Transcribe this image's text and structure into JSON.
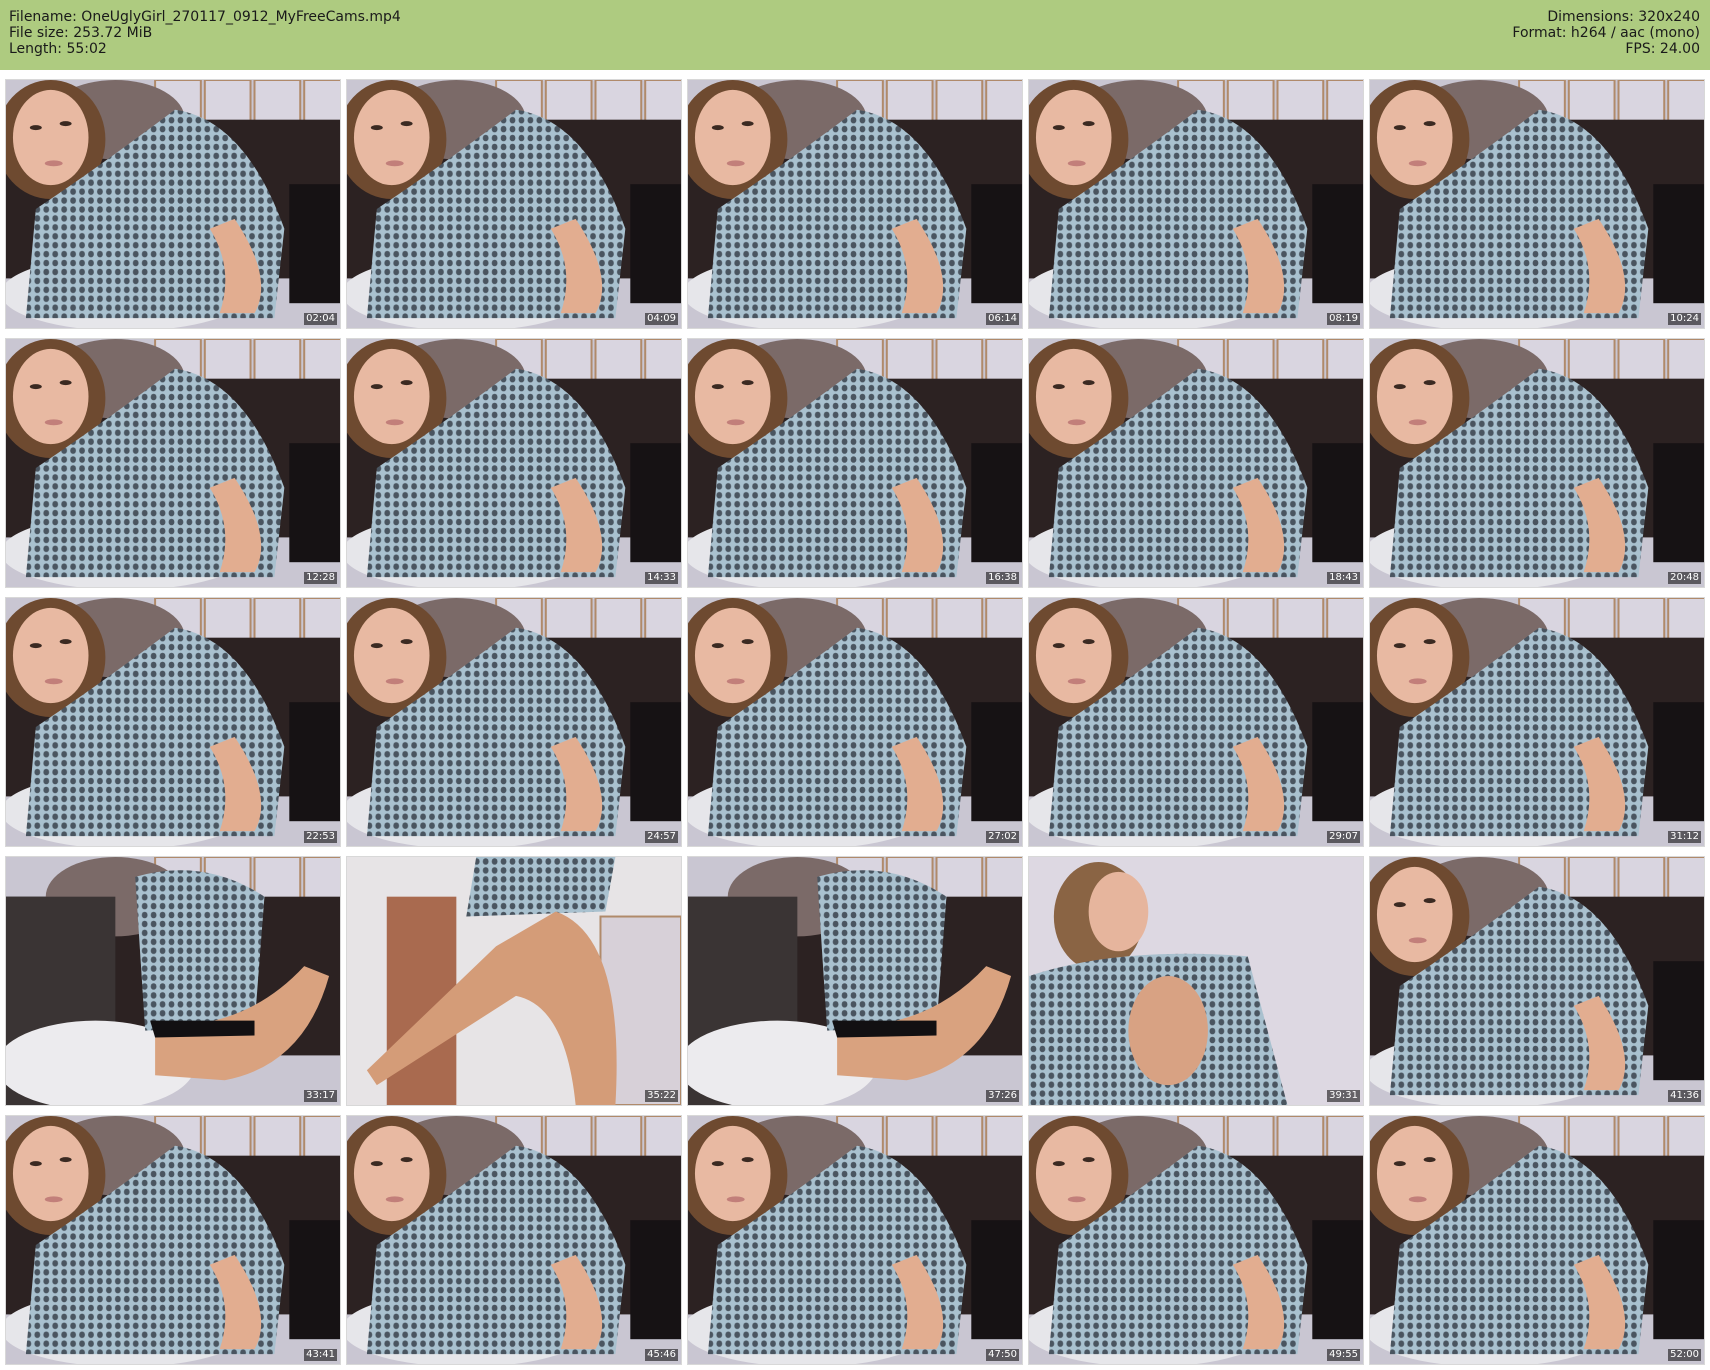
{
  "header": {
    "filename": "Filename: OneUglyGirl_270117_0912_MyFreeCams.mp4",
    "filesize": "File size: 253.72 MiB",
    "length": "Length: 55:02",
    "dimensions": "Dimensions: 320x240",
    "format": "Format: h264 / aac (mono)",
    "fps": "FPS: 24.00"
  },
  "colors": {
    "header_bg": "#aecb80"
  },
  "thumbnails": [
    {
      "time": "02:04",
      "variant": "close"
    },
    {
      "time": "04:09",
      "variant": "lying"
    },
    {
      "time": "06:14",
      "variant": "lying"
    },
    {
      "time": "08:19",
      "variant": "lying"
    },
    {
      "time": "10:24",
      "variant": "lying"
    },
    {
      "time": "12:28",
      "variant": "lying"
    },
    {
      "time": "14:33",
      "variant": "lying"
    },
    {
      "time": "16:38",
      "variant": "lying"
    },
    {
      "time": "18:43",
      "variant": "lying"
    },
    {
      "time": "20:48",
      "variant": "lying"
    },
    {
      "time": "22:53",
      "variant": "lying"
    },
    {
      "time": "24:57",
      "variant": "lying"
    },
    {
      "time": "27:02",
      "variant": "lying"
    },
    {
      "time": "29:07",
      "variant": "lying"
    },
    {
      "time": "31:12",
      "variant": "lying"
    },
    {
      "time": "33:17",
      "variant": "legs"
    },
    {
      "time": "35:22",
      "variant": "standing"
    },
    {
      "time": "37:26",
      "variant": "legs"
    },
    {
      "time": "39:31",
      "variant": "sitting"
    },
    {
      "time": "41:36",
      "variant": "close"
    },
    {
      "time": "43:41",
      "variant": "close"
    },
    {
      "time": "45:46",
      "variant": "close"
    },
    {
      "time": "47:50",
      "variant": "close"
    },
    {
      "time": "49:55",
      "variant": "close"
    },
    {
      "time": "52:00",
      "variant": "close"
    }
  ]
}
